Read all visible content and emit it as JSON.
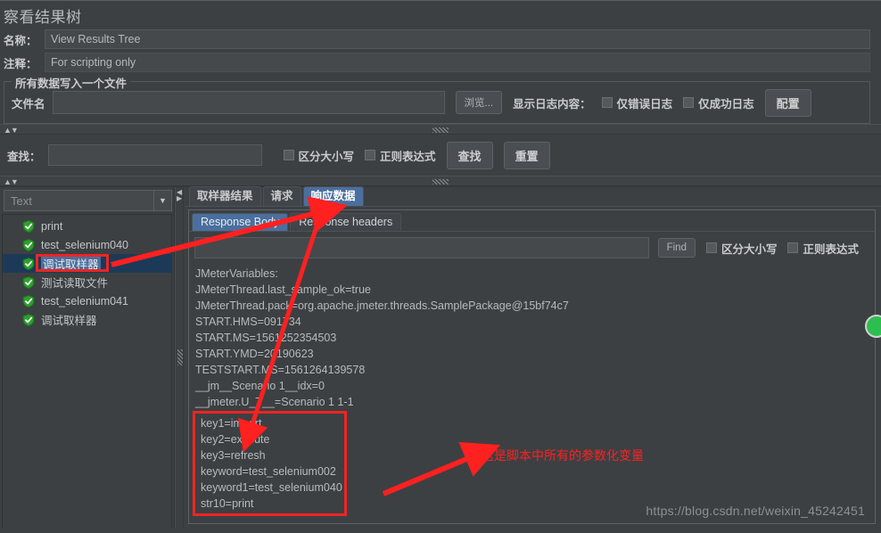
{
  "window": {
    "title": "察看结果树"
  },
  "form": {
    "name_label": "名称：",
    "name_value": "View Results Tree",
    "comment_label": "注释：",
    "comment_value": "For scripting only"
  },
  "file_group": {
    "title": "所有数据写入一个文件",
    "filename_label": "文件名",
    "filename_value": "",
    "browse_button": "浏览...",
    "log_content_label": "显示日志内容：",
    "errors_only_label": "仅错误日志",
    "success_only_label": "仅成功日志",
    "configure_button": "配置"
  },
  "search": {
    "label": "查找：",
    "value": "",
    "case_sensitive_label": "区分大小写",
    "regex_label": "正则表达式",
    "find_button": "查找",
    "reset_button": "重置"
  },
  "left_pane": {
    "combo_value": "Text",
    "combo_arrow": "▼",
    "tree_items": [
      {
        "label": "print",
        "selected": false
      },
      {
        "label": "test_selenium040",
        "selected": false
      },
      {
        "label": "调试取样器",
        "selected": true
      },
      {
        "label": "测试读取文件",
        "selected": false
      },
      {
        "label": "test_selenium041",
        "selected": false
      },
      {
        "label": "调试取样器",
        "selected": false
      }
    ]
  },
  "right_pane": {
    "tabs": [
      {
        "label": "取样器结果",
        "active": false
      },
      {
        "label": "请求",
        "active": false
      },
      {
        "label": "响应数据",
        "active": true
      }
    ],
    "subtabs": [
      {
        "label": "Response Body",
        "active": true
      },
      {
        "label": "Response headers",
        "active": false
      }
    ],
    "find_input_value": "",
    "find_button": "Find",
    "case_sensitive_label": "区分大小写",
    "regex_label": "正则表达式",
    "response_lines": [
      "JMeterVariables:",
      "JMeterThread.last_sample_ok=true",
      "JMeterThread.pack=org.apache.jmeter.threads.SamplePackage@15bf74c7",
      "START.HMS=091734",
      "START.MS=1561252354503",
      "START.YMD=20190623",
      "TESTSTART.MS=1561264139578",
      "__jm__Scenario 1__idx=0",
      "__jmeter.U_T__=Scenario 1 1-1"
    ],
    "highlighted_lines": [
      "key1=import",
      "key2=execute",
      "key3=refresh",
      "keyword=test_selenium002",
      "keyword1=test_selenium040",
      "str10=print"
    ]
  },
  "annotations": {
    "note_text": "这是脚本中所有的参数化变量",
    "watermark": "https://blog.csdn.net/weixin_45242451"
  },
  "colors": {
    "annotation_red": "#ff2020",
    "tab_active_blue": "#4a6f9e",
    "tree_selected_blue": "#1c3a57",
    "status_green": "#2cbe4e",
    "window_bg": "#3c4043"
  }
}
